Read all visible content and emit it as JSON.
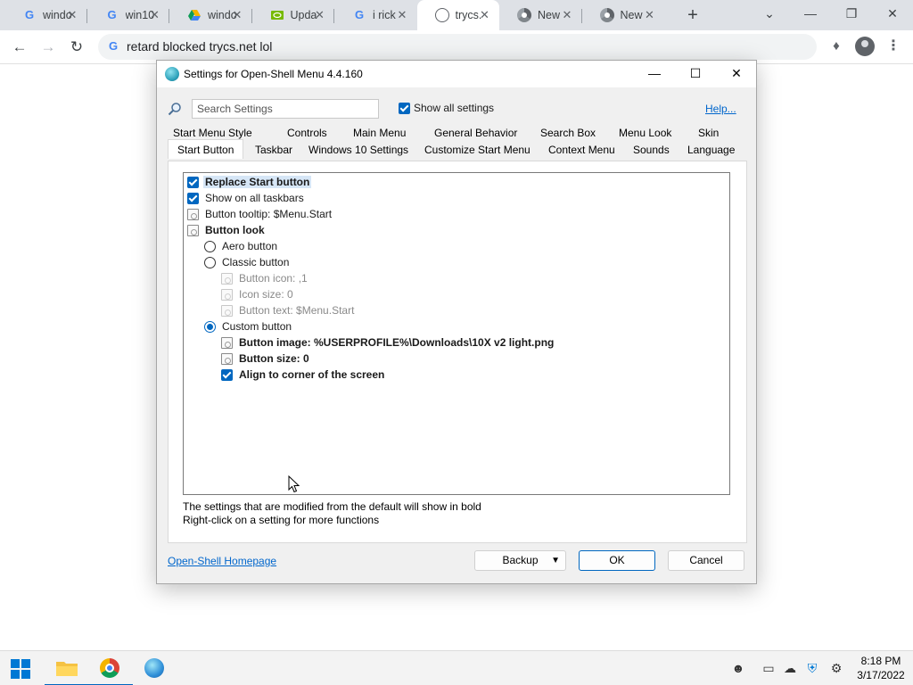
{
  "browser": {
    "tabs": [
      {
        "title": "windo",
        "favicon": "google-g-icon"
      },
      {
        "title": "win10",
        "favicon": "google-g-icon"
      },
      {
        "title": "windo",
        "favicon": "google-drive-icon"
      },
      {
        "title": "Upda",
        "favicon": "nvidia-icon"
      },
      {
        "title": "i rick",
        "favicon": "google-g-icon"
      },
      {
        "title": "trycs.",
        "favicon": "globe-icon",
        "active": true
      },
      {
        "title": "New",
        "favicon": "chrome-icon"
      },
      {
        "title": "New",
        "favicon": "chrome-icon"
      }
    ],
    "omnibox_text": "retard blocked trycs.net lol"
  },
  "dialog": {
    "title": "Settings for Open-Shell Menu 4.4.160",
    "search_placeholder": "Search Settings",
    "show_all_label": "Show all settings",
    "help_label": "Help...",
    "tabs_row1": [
      "Start Menu Style",
      "Controls",
      "Main Menu",
      "General Behavior",
      "Search Box",
      "Menu Look",
      "Skin"
    ],
    "tabs_row2": [
      "Start Button",
      "Taskbar",
      "Windows 10 Settings",
      "Customize Start Menu",
      "Context Menu",
      "Sounds",
      "Language"
    ],
    "selected_tab": "Start Button",
    "tree": [
      {
        "label": "Replace Start button",
        "control": "checkbox",
        "checked": true,
        "bold": true,
        "highlighted": true
      },
      {
        "label": "Show on all taskbars",
        "control": "checkbox",
        "checked": true
      },
      {
        "label": "Button tooltip: $Menu.Start",
        "control": "setting"
      },
      {
        "label": "Button look",
        "control": "setting",
        "bold": true
      },
      {
        "label": "Aero button",
        "control": "radio",
        "checked": false
      },
      {
        "label": "Classic button",
        "control": "radio",
        "checked": false
      },
      {
        "label": "Button icon: ,1",
        "control": "setting",
        "disabled": true
      },
      {
        "label": "Icon size: 0",
        "control": "setting",
        "disabled": true
      },
      {
        "label": "Button text: $Menu.Start",
        "control": "setting",
        "disabled": true
      },
      {
        "label": "Custom button",
        "control": "radio",
        "checked": true
      },
      {
        "label": "Button image: %USERPROFILE%\\Downloads\\10X v2 light.png",
        "control": "setting",
        "bold": true
      },
      {
        "label": "Button size: 0",
        "control": "setting",
        "bold": true
      },
      {
        "label": "Align to corner of the screen",
        "control": "checkbox",
        "checked": true,
        "bold": true
      }
    ],
    "note_line1": "The settings that are modified from the default will show in bold",
    "note_line2": "Right-click on a setting for more functions",
    "homepage_link": "Open-Shell Homepage",
    "backup_label": "Backup",
    "ok_label": "OK",
    "cancel_label": "Cancel"
  },
  "taskbar": {
    "time": "8:18 PM",
    "date": "3/17/2022"
  },
  "colors": {
    "accent": "#0067c0",
    "link": "#0066cc",
    "disabled_text": "#8a8a8a"
  }
}
